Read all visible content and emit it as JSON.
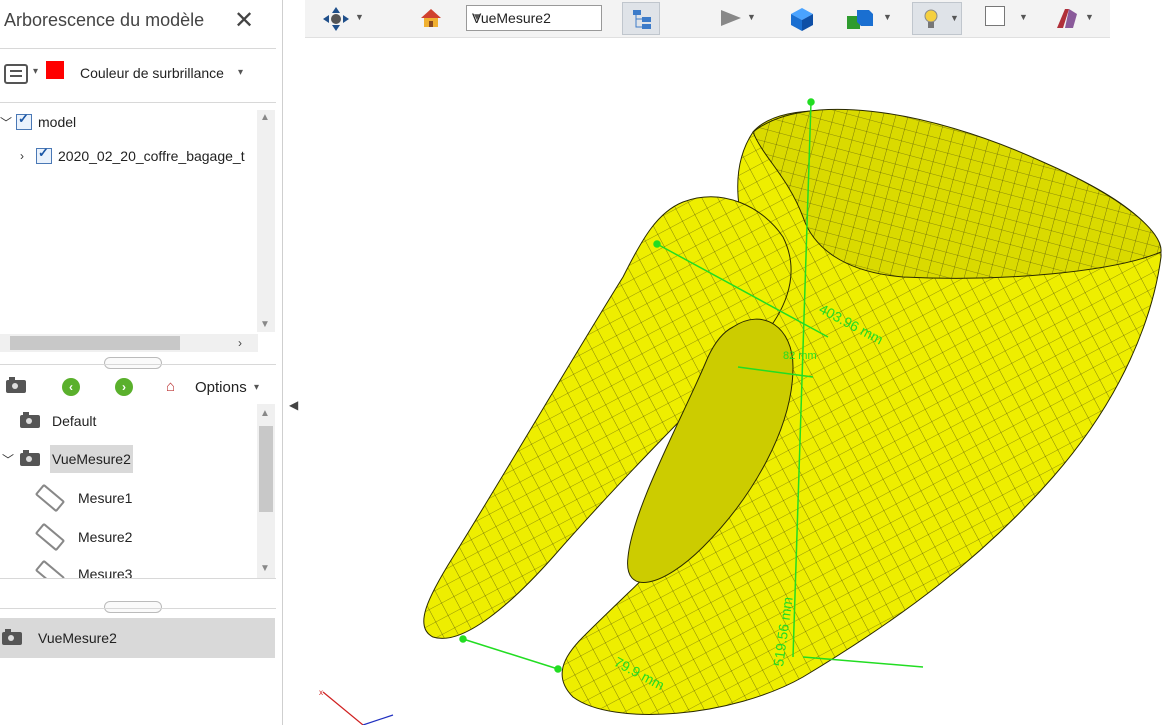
{
  "panel": {
    "title": "Arborescence du modèle",
    "close_icon": "close-icon"
  },
  "highlight": {
    "label": "Couleur de surbrillance",
    "color": "#ff0000"
  },
  "tree": {
    "items": [
      {
        "label": "model",
        "expanded": true,
        "checked": true
      },
      {
        "label": "2020_02_20_coffre_bagage_t",
        "expanded": false,
        "checked": true
      }
    ]
  },
  "views_toolbar": {
    "options_label": "Options"
  },
  "views": {
    "items": [
      {
        "label": "Default"
      },
      {
        "label": "VueMesure2",
        "selected": true
      },
      {
        "label": "Mesure1"
      },
      {
        "label": "Mesure2"
      },
      {
        "label": "Mesure3"
      }
    ]
  },
  "current_view": {
    "label": "VueMesure2"
  },
  "toolbar": {
    "view_select": "VueMesure2"
  },
  "measurements": {
    "m1": "403.96 mm",
    "m2": "82 mm",
    "m3": "519.56 mm",
    "m4": "79.9 mm"
  },
  "colors": {
    "model": "#f0f000",
    "measure": "#22dd22"
  }
}
